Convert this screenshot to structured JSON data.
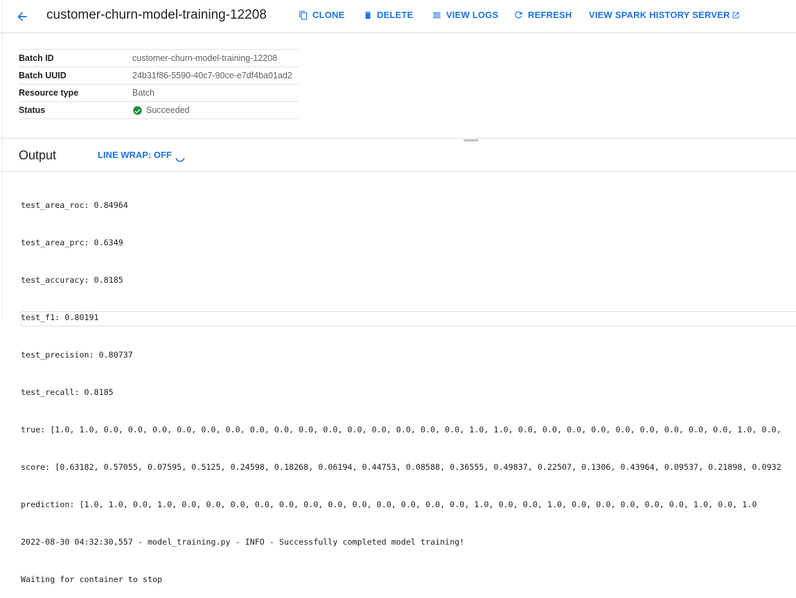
{
  "header": {
    "title": "customer-churn-model-training-12208",
    "actions": [
      {
        "label": "CLONE",
        "icon": "copy-icon"
      },
      {
        "label": "DELETE",
        "icon": "trash-icon"
      },
      {
        "label": "VIEW LOGS",
        "icon": "list-icon"
      },
      {
        "label": "REFRESH",
        "icon": "refresh-icon"
      },
      {
        "label": "VIEW SPARK HISTORY SERVER",
        "icon": "external-link-icon"
      }
    ]
  },
  "details": [
    {
      "key": "Batch ID",
      "value": "customer-churn-model-training-12208"
    },
    {
      "key": "Batch UUID",
      "value": "24b31f86-5590-40c7-90ce-e7df4ba01ad2"
    },
    {
      "key": "Resource type",
      "value": "Batch"
    },
    {
      "key": "Status",
      "value": "Succeeded",
      "icon": "check-circle-icon",
      "color": "#1e8e3e"
    }
  ],
  "output": {
    "title": "Output",
    "line_wrap_label": "LINE WRAP: OFF",
    "lines": [
      "test_area_roc: 0.84964",
      "test_area_prc: 0.6349",
      "test_accuracy: 0.8185",
      "test_f1: 0.80191",
      "test_precision: 0.80737",
      "test_recall: 0.8185",
      "true: [1.0, 1.0, 0.0, 0.0, 0.0, 0.0, 0.0, 0.0, 0.0, 0.0, 0.0, 0.0, 0.0, 0.0, 0.0, 0.0, 0.0, 1.0, 1.0, 0.0, 0.0, 0.0, 0.0, 0.0, 0.0, 0.0, 0.0, 0.0, 1.0, 0.0,",
      "score: [0.63182, 0.57055, 0.07595, 0.5125, 0.24598, 0.18268, 0.06194, 0.44753, 0.08588, 0.36555, 0.49837, 0.22507, 0.1306, 0.43964, 0.09537, 0.21898, 0.0932",
      "prediction: [1.0, 1.0, 0.0, 1.0, 0.0, 0.0, 0.0, 0.0, 0.0, 0.0, 0.0, 0.0, 0.0, 0.0, 0.0, 0.0, 1.0, 0.0, 0.0, 1.0, 0.0, 0.0, 0.0, 0.0, 0.0, 1.0, 0.0, 1.0",
      "2022-08-30 04:32:30,557 - model_training.py - INFO - Successfully completed model training!",
      "Waiting for container to stop"
    ]
  },
  "colors": {
    "accent": "#1a73e8",
    "success": "#1e8e3e"
  }
}
